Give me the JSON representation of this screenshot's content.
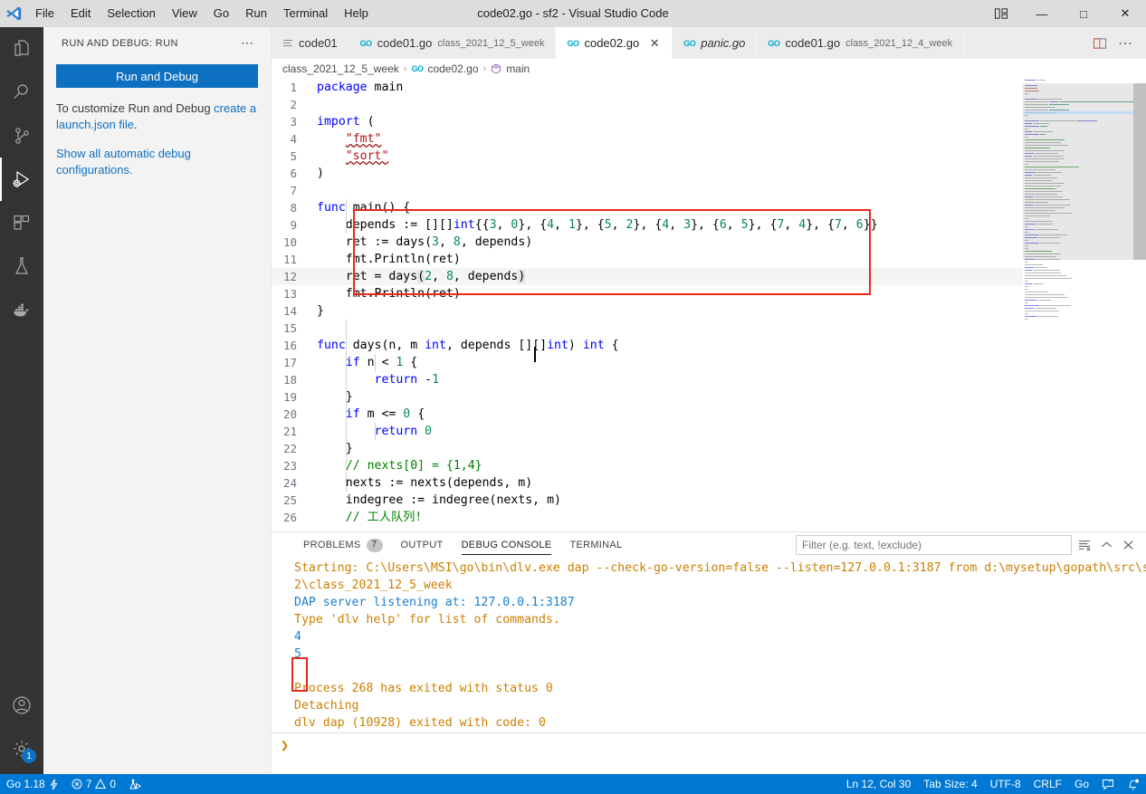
{
  "titlebar": {
    "title": "code02.go - sf2 - Visual Studio Code",
    "menus": [
      "File",
      "Edit",
      "Selection",
      "View",
      "Go",
      "Run",
      "Terminal",
      "Help"
    ],
    "layout_icon": "editor-layout-icon",
    "minimize": "—",
    "maximize": "□",
    "close": "✕"
  },
  "activitybar": {
    "items": [
      {
        "name": "explorer-icon",
        "active": false
      },
      {
        "name": "search-icon",
        "active": false
      },
      {
        "name": "source-control-icon",
        "active": false
      },
      {
        "name": "run-and-debug-icon",
        "active": true
      },
      {
        "name": "extensions-icon",
        "active": false
      },
      {
        "name": "testing-icon",
        "active": false
      },
      {
        "name": "docker-icon",
        "active": false
      }
    ],
    "account_icon": "account-icon",
    "settings_icon": "gear-icon",
    "settings_badge": "1"
  },
  "sidebar": {
    "title": "RUN AND DEBUG: RUN",
    "more_actions": "⋯",
    "run_button": "Run and Debug",
    "help_text_1a": "To customize Run and Debug ",
    "help_link_1": "create a launch.json file",
    "help_text_1b": ".",
    "help_link_2": "Show all automatic debug configurations."
  },
  "tabs": [
    {
      "name": "code01",
      "description": "",
      "icon": "text-file-icon",
      "active": false,
      "italic": false,
      "closable": false
    },
    {
      "name": "code01.go",
      "description": "class_2021_12_5_week",
      "icon": "go-file-icon",
      "active": false,
      "italic": false,
      "closable": false
    },
    {
      "name": "code02.go",
      "description": "",
      "icon": "go-file-icon",
      "active": true,
      "italic": false,
      "closable": true
    },
    {
      "name": "panic.go",
      "description": "",
      "icon": "go-file-icon",
      "active": false,
      "italic": true,
      "closable": false
    },
    {
      "name": "code01.go",
      "description": "class_2021_12_4_week",
      "icon": "go-file-icon",
      "active": false,
      "italic": false,
      "closable": false
    }
  ],
  "tabbar_actions": [
    {
      "name": "split-editor-icon"
    },
    {
      "name": "more-actions-icon",
      "label": "⋯"
    }
  ],
  "breadcrumbs": [
    {
      "label": "class_2021_12_5_week",
      "icon": ""
    },
    {
      "label": "code02.go",
      "icon": "go-file-icon"
    },
    {
      "label": "main",
      "icon": "symbol-namespace-icon"
    }
  ],
  "editor": {
    "language": "go",
    "lines": [
      {
        "n": 1,
        "text": "package main"
      },
      {
        "n": 2,
        "text": ""
      },
      {
        "n": 3,
        "text": "import ("
      },
      {
        "n": 4,
        "text": "    \"fmt\""
      },
      {
        "n": 5,
        "text": "    \"sort\""
      },
      {
        "n": 6,
        "text": ")"
      },
      {
        "n": 7,
        "text": ""
      },
      {
        "n": 8,
        "text": "func main() {"
      },
      {
        "n": 9,
        "text": "    depends := [][]int{{3, 0}, {4, 1}, {5, 2}, {4, 3}, {6, 5}, {7, 4}, {7, 6}}"
      },
      {
        "n": 10,
        "text": "    ret := days(3, 8, depends)"
      },
      {
        "n": 11,
        "text": "    fmt.Println(ret)"
      },
      {
        "n": 12,
        "text": "    ret = days(2, 8, depends)"
      },
      {
        "n": 13,
        "text": "    fmt.Println(ret)"
      },
      {
        "n": 14,
        "text": "}"
      },
      {
        "n": 15,
        "text": ""
      },
      {
        "n": 16,
        "text": "func days(n, m int, depends [][]int) int {"
      },
      {
        "n": 17,
        "text": "    if n < 1 {"
      },
      {
        "n": 18,
        "text": "        return -1"
      },
      {
        "n": 19,
        "text": "    }"
      },
      {
        "n": 20,
        "text": "    if m <= 0 {"
      },
      {
        "n": 21,
        "text": "        return 0"
      },
      {
        "n": 22,
        "text": "    }"
      },
      {
        "n": 23,
        "text": "    // nexts[0] = {1,4}"
      },
      {
        "n": 24,
        "text": "    nexts := nexts(depends, m)"
      },
      {
        "n": 25,
        "text": "    indegree := indegree(nexts, m)"
      },
      {
        "n": 26,
        "text": "    // 工人队列!"
      }
    ],
    "highlight_color": "#e8291c",
    "cursor_line": 12
  },
  "panel": {
    "tabs": [
      {
        "label": "PROBLEMS",
        "count": "7",
        "active": false
      },
      {
        "label": "OUTPUT",
        "count": "",
        "active": false
      },
      {
        "label": "DEBUG CONSOLE",
        "count": "",
        "active": true
      },
      {
        "label": "TERMINAL",
        "count": "",
        "active": false
      }
    ],
    "filter_placeholder": "Filter (e.g. text, !exclude)",
    "filter_value": "",
    "actions": [
      {
        "name": "clear-console-icon"
      },
      {
        "name": "collapse-panel-icon",
        "label": "ⱏ"
      },
      {
        "name": "close-panel-icon",
        "label": "✕"
      }
    ],
    "console_lines": [
      {
        "text": "Starting: C:\\Users\\MSI\\go\\bin\\dlv.exe dap --check-go-version=false --listen=127.0.0.1:3187 from d:\\mysetup\\gopath\\src\\sf",
        "color": "orange"
      },
      {
        "text": "2\\class_2021_12_5_week",
        "color": "orange"
      },
      {
        "text": "DAP server listening at: 127.0.0.1:3187",
        "color": "blue"
      },
      {
        "text": "Type 'dlv help' for list of commands.",
        "color": "orange"
      },
      {
        "text": "4",
        "color": "value"
      },
      {
        "text": "5",
        "color": "value"
      },
      {
        "text": "",
        "color": "orange"
      },
      {
        "text": "Process 268 has exited with status 0",
        "color": "orange"
      },
      {
        "text": "Detaching",
        "color": "orange"
      },
      {
        "text": "dlv dap (10928) exited with code: 0",
        "color": "orange"
      }
    ],
    "prompt": "❯"
  },
  "statusbar": {
    "left": [
      {
        "name": "go-version",
        "label": "Go 1.18",
        "icon": "lightning-icon"
      },
      {
        "name": "problems",
        "label": "7  0",
        "error_count": "7",
        "warning_count": "0",
        "icon": "error-warning-icon"
      },
      {
        "name": "go-test-icon",
        "label": "",
        "icon": "beaker-run-icon"
      }
    ],
    "right": [
      {
        "name": "cursor-position",
        "label": "Ln 12, Col 30"
      },
      {
        "name": "tab-size",
        "label": "Tab Size: 4"
      },
      {
        "name": "encoding",
        "label": "UTF-8"
      },
      {
        "name": "eol",
        "label": "CRLF"
      },
      {
        "name": "language-mode",
        "label": "Go"
      },
      {
        "name": "feedback-icon",
        "label": ""
      },
      {
        "name": "notifications-bell-icon",
        "label": ""
      }
    ]
  },
  "colors": {
    "accent": "#0078d4",
    "button": "#0e70c0",
    "highlight_box": "#e8291c",
    "activity_bg": "#333333",
    "sidebar_bg": "#f3f3f3"
  }
}
